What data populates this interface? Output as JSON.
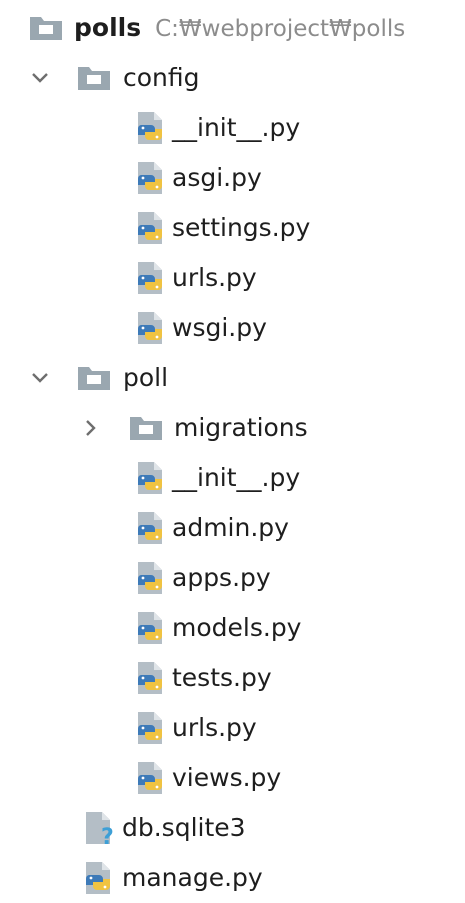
{
  "project": {
    "name": "polls",
    "path": "C:₩webproject₩polls"
  },
  "config": {
    "name": "config",
    "files": [
      "__init__.py",
      "asgi.py",
      "settings.py",
      "urls.py",
      "wsgi.py"
    ]
  },
  "poll": {
    "name": "poll",
    "subfolder": "migrations",
    "files": [
      "__init__.py",
      "admin.py",
      "apps.py",
      "models.py",
      "tests.py",
      "urls.py",
      "views.py"
    ]
  },
  "root_files": [
    "db.sqlite3",
    "manage.py"
  ],
  "icons": {
    "folder": "folder-icon",
    "python": "python-file-icon",
    "unknown": "unknown-file-icon",
    "expanded": "chevron-down-icon",
    "collapsed": "chevron-right-icon"
  },
  "colors": {
    "folder": "#9aa7b0",
    "python_blue": "#3d7ab8",
    "python_yellow": "#f0c341",
    "file_page": "#9aa7b0",
    "unknown_mark": "#3d9fd6",
    "path_text": "#8c8c8c"
  }
}
